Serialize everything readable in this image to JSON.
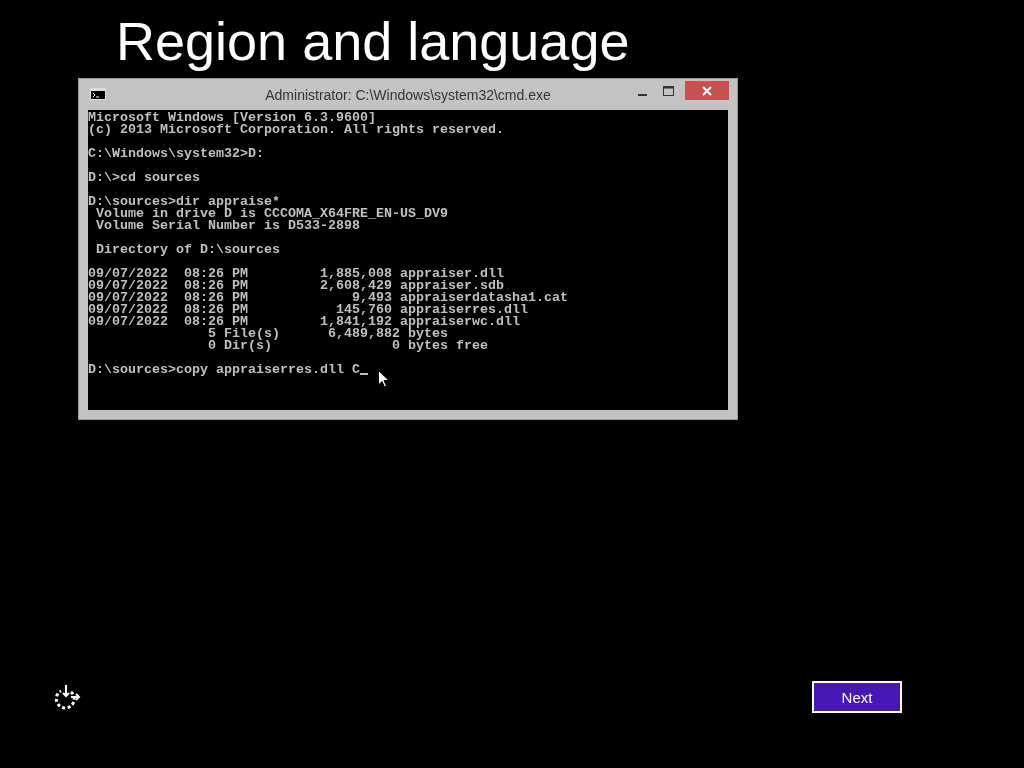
{
  "page_title": "Region and language",
  "console_window": {
    "title": "Administrator: C:\\Windows\\system32\\cmd.exe",
    "blocks": [
      [
        "Microsoft Windows [Version 6.3.9600]",
        "(c) 2013 Microsoft Corporation. All rights reserved."
      ],
      [
        "C:\\Windows\\system32>D:"
      ],
      [
        "D:\\>cd sources"
      ],
      [
        "D:\\sources>dir appraise*",
        " Volume in drive D is CCCOMA_X64FRE_EN-US_DV9",
        " Volume Serial Number is D533-2898"
      ],
      [
        " Directory of D:\\sources"
      ],
      [
        "09/07/2022  08:26 PM         1,885,008 appraiser.dll",
        "09/07/2022  08:26 PM         2,608,429 appraiser.sdb",
        "09/07/2022  08:26 PM             9,493 appraiserdatasha1.cat",
        "09/07/2022  08:26 PM           145,760 appraiserres.dll",
        "09/07/2022  08:26 PM         1,841,192 appraiserwc.dll",
        "               5 File(s)      6,489,882 bytes",
        "               0 Dir(s)               0 bytes free"
      ]
    ],
    "prompt": "D:\\sources>copy appraiserres.dll C"
  },
  "next_button": "Next"
}
